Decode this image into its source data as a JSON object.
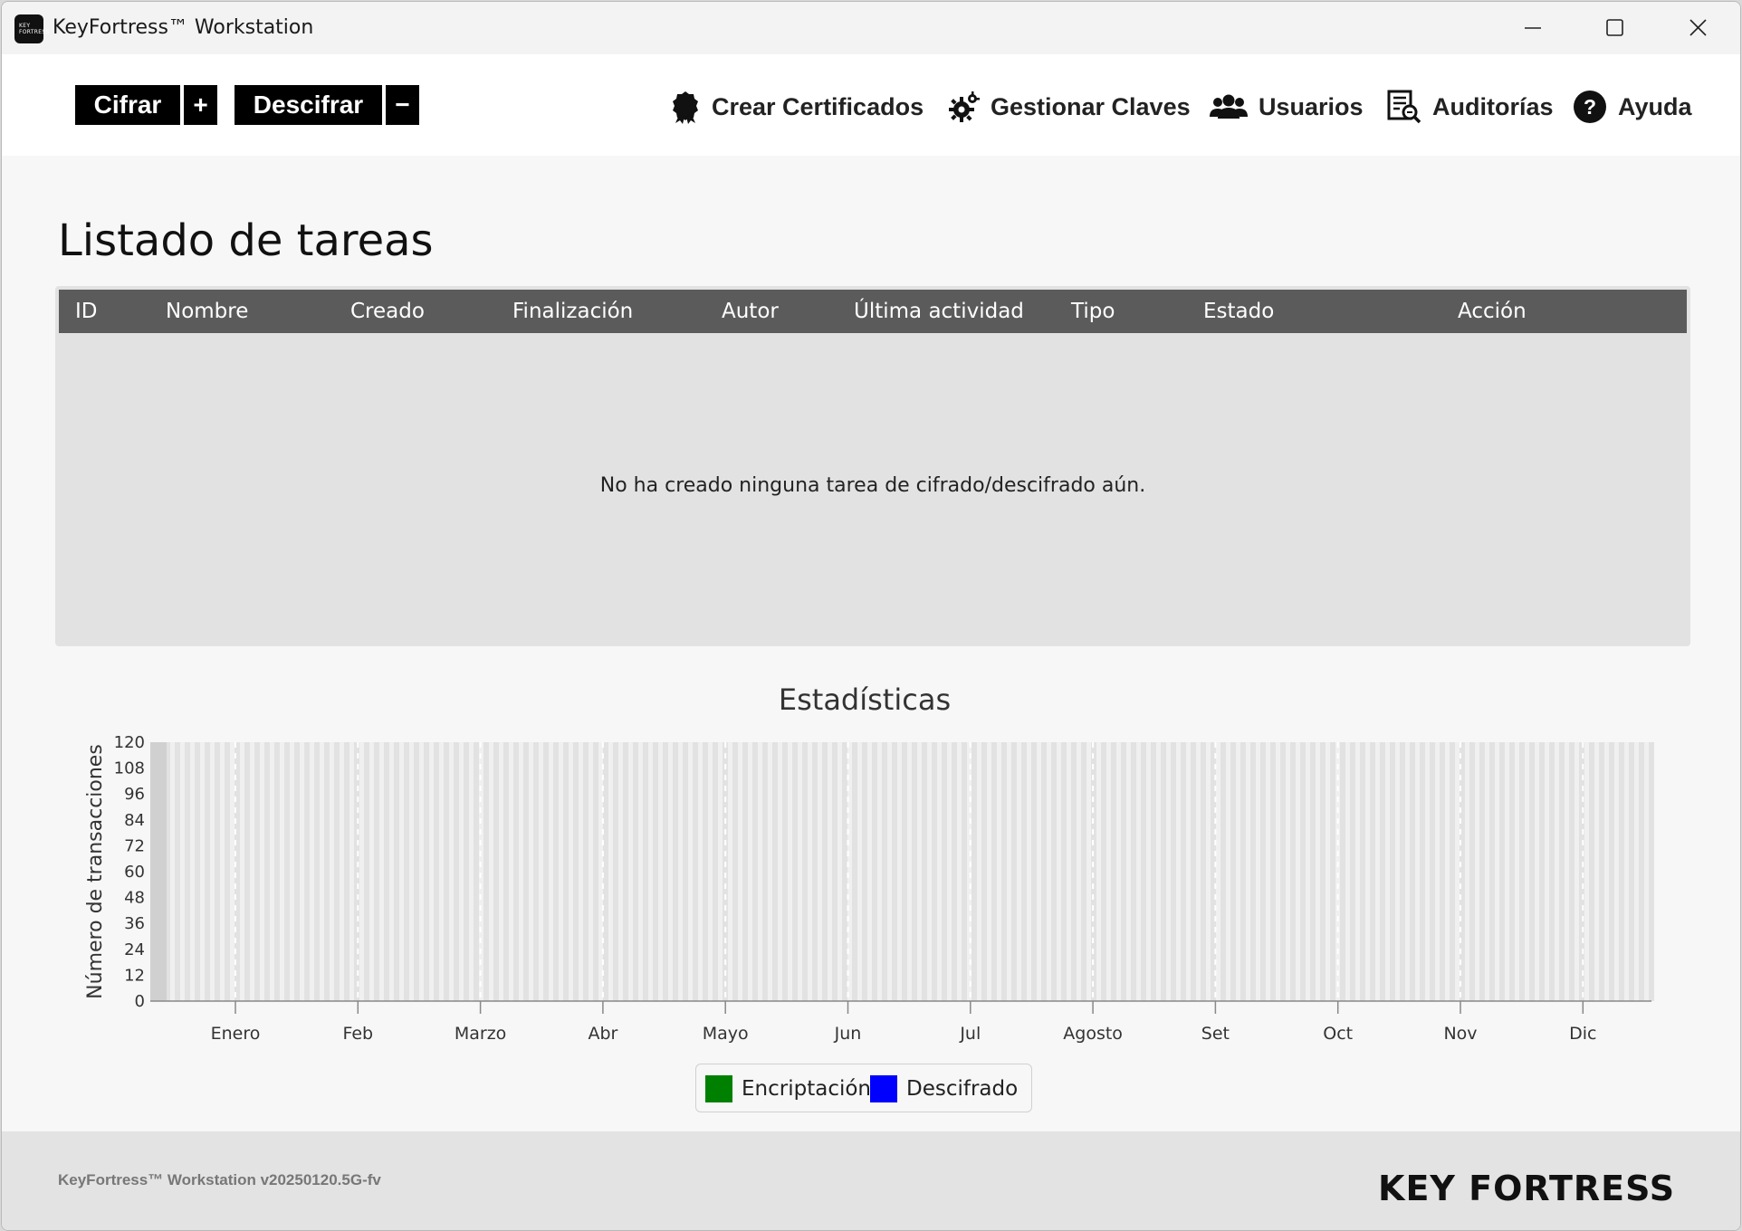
{
  "window": {
    "title": "KeyFortress™ Workstation",
    "icon_text_top": "KEY",
    "icon_text_bottom": "FORTRESS"
  },
  "toolbar": {
    "cifrar_label": "Cifrar",
    "plus_label": "+",
    "descifrar_label": "Descifrar",
    "minus_label": "−",
    "nav": {
      "certificates": "Crear Certificados",
      "keys": "Gestionar Claves",
      "users": "Usuarios",
      "audits": "Auditorías",
      "help": "Ayuda"
    }
  },
  "tasks": {
    "title": "Listado de tareas",
    "columns": [
      "ID",
      "Nombre",
      "Creado",
      "Finalización",
      "Autor",
      "Última actividad",
      "Tipo",
      "Estado",
      "Acción"
    ],
    "empty_message": "No ha creado ninguna tarea de cifrado/descifrado aún."
  },
  "chart_data": {
    "type": "bar",
    "title": "Estadísticas",
    "xlabel": "",
    "ylabel": "Número de transacciones",
    "categories": [
      "Enero",
      "Feb",
      "Marzo",
      "Abr",
      "Mayo",
      "Jun",
      "Jul",
      "Agosto",
      "Set",
      "Oct",
      "Nov",
      "Dic"
    ],
    "ylim": [
      0,
      120
    ],
    "yticks": [
      0,
      12,
      24,
      36,
      48,
      60,
      72,
      84,
      96,
      108,
      120
    ],
    "series": [
      {
        "name": "Encriptación",
        "color": "#008000",
        "values": [
          0,
          0,
          0,
          0,
          0,
          0,
          0,
          0,
          0,
          0,
          0,
          0
        ]
      },
      {
        "name": "Descifrado",
        "color": "#0000ff",
        "values": [
          0,
          0,
          0,
          0,
          0,
          0,
          0,
          0,
          0,
          0,
          0,
          0
        ]
      }
    ],
    "grid": true,
    "legend": "bottom-center"
  },
  "footer": {
    "version": "KeyFortress™ Workstation v20250120.5G-fv",
    "logo_text": "KEY FORTRESS™"
  }
}
